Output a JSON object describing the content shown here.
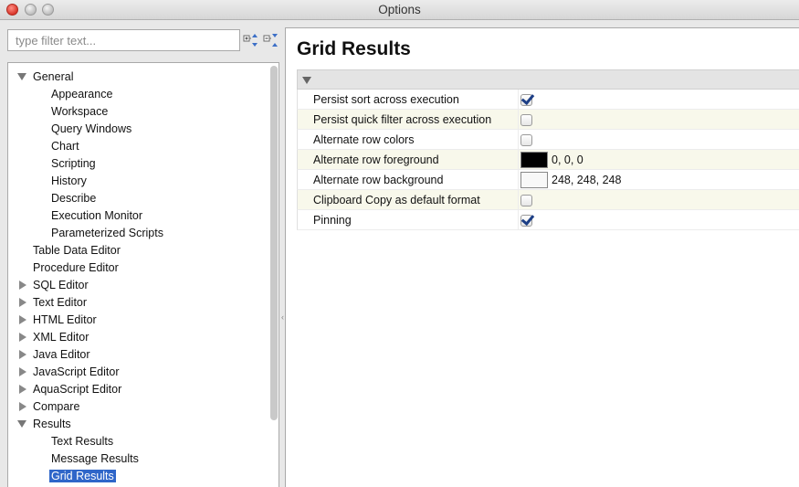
{
  "window": {
    "title": "Options"
  },
  "filter": {
    "placeholder": "type filter text..."
  },
  "tree": {
    "items": [
      {
        "label": "General",
        "level": 0,
        "expander": "expanded"
      },
      {
        "label": "Appearance",
        "level": 1
      },
      {
        "label": "Workspace",
        "level": 1
      },
      {
        "label": "Query Windows",
        "level": 1
      },
      {
        "label": "Chart",
        "level": 1
      },
      {
        "label": "Scripting",
        "level": 1
      },
      {
        "label": "History",
        "level": 1
      },
      {
        "label": "Describe",
        "level": 1
      },
      {
        "label": "Execution Monitor",
        "level": 1
      },
      {
        "label": "Parameterized Scripts",
        "level": 1
      },
      {
        "label": "Table Data Editor",
        "level": 0
      },
      {
        "label": "Procedure Editor",
        "level": 0
      },
      {
        "label": "SQL Editor",
        "level": 0,
        "expander": "collapsed"
      },
      {
        "label": "Text Editor",
        "level": 0,
        "expander": "collapsed"
      },
      {
        "label": "HTML Editor",
        "level": 0,
        "expander": "collapsed"
      },
      {
        "label": "XML Editor",
        "level": 0,
        "expander": "collapsed"
      },
      {
        "label": "Java Editor",
        "level": 0,
        "expander": "collapsed"
      },
      {
        "label": "JavaScript Editor",
        "level": 0,
        "expander": "collapsed"
      },
      {
        "label": "AquaScript Editor",
        "level": 0,
        "expander": "collapsed"
      },
      {
        "label": "Compare",
        "level": 0,
        "expander": "collapsed"
      },
      {
        "label": "Results",
        "level": 0,
        "expander": "expanded"
      },
      {
        "label": "Text Results",
        "level": 1
      },
      {
        "label": "Message Results",
        "level": 1
      },
      {
        "label": "Grid Results",
        "level": 1,
        "selected": true
      }
    ]
  },
  "page": {
    "title": "Grid Results"
  },
  "properties": [
    {
      "name": "Persist sort across execution",
      "type": "checkbox",
      "checked": true
    },
    {
      "name": "Persist quick filter across execution",
      "type": "checkbox",
      "checked": false
    },
    {
      "name": "Alternate row colors",
      "type": "checkbox",
      "checked": false
    },
    {
      "name": "Alternate row foreground",
      "type": "color",
      "color": "#000000",
      "value": "0, 0, 0"
    },
    {
      "name": "Alternate row background",
      "type": "color",
      "color": "#f8f8f8",
      "value": "248, 248, 248"
    },
    {
      "name": "Clipboard Copy as default format",
      "type": "checkbox",
      "checked": false
    },
    {
      "name": "Pinning",
      "type": "checkbox",
      "checked": true
    }
  ],
  "colors": {
    "selection": "#2f66c9",
    "alt_row": "#f8f8eb"
  }
}
